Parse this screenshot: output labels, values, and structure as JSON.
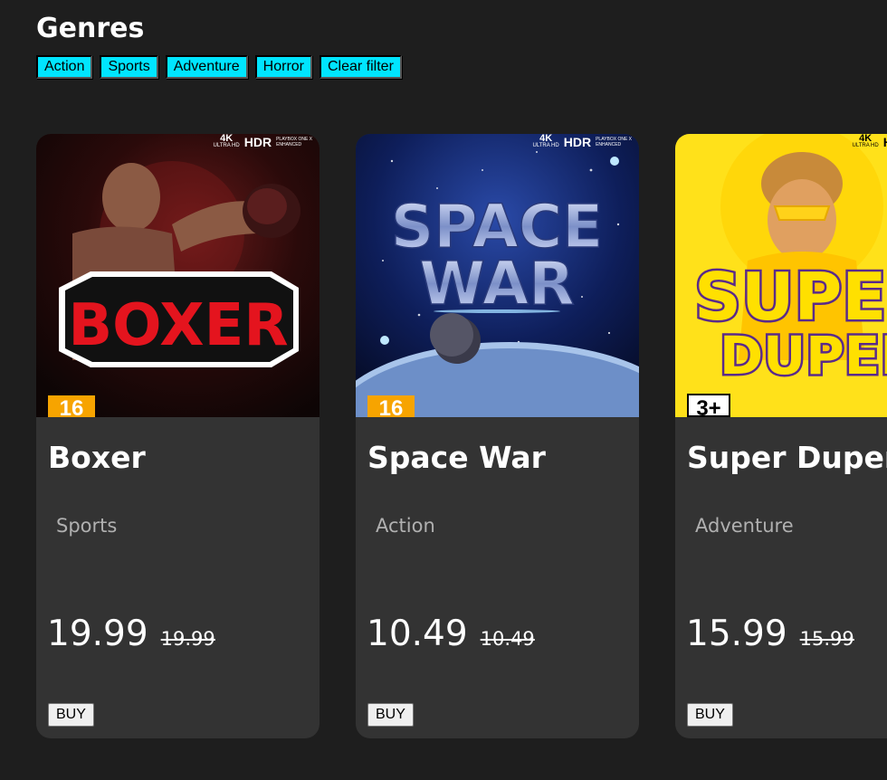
{
  "genres": {
    "title": "Genres",
    "filters": [
      "Action",
      "Sports",
      "Adventure",
      "Horror",
      "Clear filter"
    ]
  },
  "cover_badges": {
    "k4": "4K",
    "ultra_hd": "ULTRA HD",
    "hdr": "HDR",
    "playbox_line1": "PLAYBOX ONE X",
    "playbox_line2": "ENHANCED"
  },
  "games": [
    {
      "title": "Boxer",
      "genre": "Sports",
      "price": "19.99",
      "old_price": "19.99",
      "buy_label": "BUY",
      "rating": "16",
      "cover_text": "BOXER",
      "accent": "#e4141e"
    },
    {
      "title": "Space War",
      "genre": "Action",
      "price": "10.49",
      "old_price": "10.49",
      "buy_label": "BUY",
      "rating": "16",
      "cover_text_line1": "SPACE",
      "cover_text_line2": "WAR",
      "accent": "#9fb3e8"
    },
    {
      "title": "Super Duper",
      "genre": "Adventure",
      "price": "15.99",
      "old_price": "15.99",
      "buy_label": "BUY",
      "rating": "3+",
      "cover_text_line1": "SUPER",
      "cover_text_line2": "DUPER",
      "accent": "#ffd21a"
    }
  ]
}
